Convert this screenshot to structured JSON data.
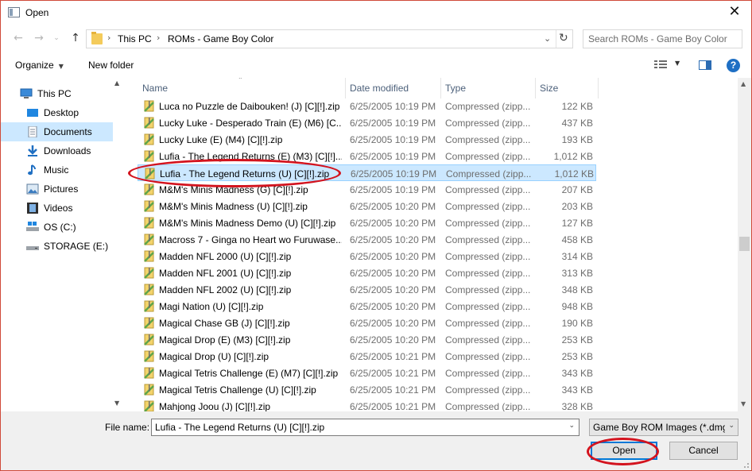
{
  "window": {
    "title": "Open",
    "close_glyph": "✕"
  },
  "address": {
    "crumbs": [
      "This PC",
      "ROMs - Game Boy Color"
    ],
    "search_placeholder": "Search ROMs - Game Boy Color"
  },
  "toolbar": {
    "organize": "Organize",
    "new_folder": "New folder",
    "help": "?"
  },
  "nav": {
    "items": [
      {
        "label": "This PC",
        "icon": "computer-icon"
      },
      {
        "label": "Desktop",
        "icon": "desktop-icon"
      },
      {
        "label": "Documents",
        "icon": "documents-icon",
        "selected": true
      },
      {
        "label": "Downloads",
        "icon": "downloads-icon"
      },
      {
        "label": "Music",
        "icon": "music-icon"
      },
      {
        "label": "Pictures",
        "icon": "pictures-icon"
      },
      {
        "label": "Videos",
        "icon": "videos-icon"
      },
      {
        "label": "OS (C:)",
        "icon": "drive-icon"
      },
      {
        "label": "STORAGE (E:)",
        "icon": "drive-icon"
      }
    ]
  },
  "list": {
    "columns": {
      "name": "Name",
      "date": "Date modified",
      "type": "Type",
      "size": "Size"
    },
    "files": [
      {
        "name": "Luca no Puzzle de Daibouken! (J) [C][!].zip",
        "date": "6/25/2005 10:19 PM",
        "type": "Compressed (zipp...",
        "size": "122 KB"
      },
      {
        "name": "Lucky Luke - Desperado Train (E) (M6) [C...",
        "date": "6/25/2005 10:19 PM",
        "type": "Compressed (zipp...",
        "size": "437 KB"
      },
      {
        "name": "Lucky Luke (E) (M4) [C][!].zip",
        "date": "6/25/2005 10:19 PM",
        "type": "Compressed (zipp...",
        "size": "193 KB"
      },
      {
        "name": "Lufia - The Legend Returns (E) (M3) [C][!]...",
        "date": "6/25/2005 10:19 PM",
        "type": "Compressed (zipp...",
        "size": "1,012 KB"
      },
      {
        "name": "Lufia - The Legend Returns (U) [C][!].zip",
        "date": "6/25/2005 10:19 PM",
        "type": "Compressed (zipp...",
        "size": "1,012 KB",
        "selected": true
      },
      {
        "name": "M&M's Minis Madness (G) [C][!].zip",
        "date": "6/25/2005 10:19 PM",
        "type": "Compressed (zipp...",
        "size": "207 KB"
      },
      {
        "name": "M&M's Minis Madness (U) [C][!].zip",
        "date": "6/25/2005 10:20 PM",
        "type": "Compressed (zipp...",
        "size": "203 KB"
      },
      {
        "name": "M&M's Minis Madness Demo (U) [C][!].zip",
        "date": "6/25/2005 10:20 PM",
        "type": "Compressed (zipp...",
        "size": "127 KB"
      },
      {
        "name": "Macross 7 - Ginga no Heart wo Furuwase...",
        "date": "6/25/2005 10:20 PM",
        "type": "Compressed (zipp...",
        "size": "458 KB"
      },
      {
        "name": "Madden NFL 2000 (U) [C][!].zip",
        "date": "6/25/2005 10:20 PM",
        "type": "Compressed (zipp...",
        "size": "314 KB"
      },
      {
        "name": "Madden NFL 2001 (U) [C][!].zip",
        "date": "6/25/2005 10:20 PM",
        "type": "Compressed (zipp...",
        "size": "313 KB"
      },
      {
        "name": "Madden NFL 2002 (U) [C][!].zip",
        "date": "6/25/2005 10:20 PM",
        "type": "Compressed (zipp...",
        "size": "348 KB"
      },
      {
        "name": "Magi Nation (U) [C][!].zip",
        "date": "6/25/2005 10:20 PM",
        "type": "Compressed (zipp...",
        "size": "948 KB"
      },
      {
        "name": "Magical Chase GB (J) [C][!].zip",
        "date": "6/25/2005 10:20 PM",
        "type": "Compressed (zipp...",
        "size": "190 KB"
      },
      {
        "name": "Magical Drop (E) (M3) [C][!].zip",
        "date": "6/25/2005 10:20 PM",
        "type": "Compressed (zipp...",
        "size": "253 KB"
      },
      {
        "name": "Magical Drop (U) [C][!].zip",
        "date": "6/25/2005 10:21 PM",
        "type": "Compressed (zipp...",
        "size": "253 KB"
      },
      {
        "name": "Magical Tetris Challenge (E) (M7) [C][!].zip",
        "date": "6/25/2005 10:21 PM",
        "type": "Compressed (zipp...",
        "size": "343 KB"
      },
      {
        "name": "Magical Tetris Challenge (U) [C][!].zip",
        "date": "6/25/2005 10:21 PM",
        "type": "Compressed (zipp...",
        "size": "343 KB"
      },
      {
        "name": "Mahjong Joou (J) [C][!].zip",
        "date": "6/25/2005 10:21 PM",
        "type": "Compressed (zipp...",
        "size": "328 KB"
      }
    ]
  },
  "bottom": {
    "file_name_label": "File name:",
    "file_name_value": "Lufia - The Legend Returns (U) [C][!].zip",
    "filter_value": "Game Boy ROM Images (*.dmg",
    "open_button": "Open",
    "cancel_button": "Cancel"
  },
  "colors": {
    "selection": "#cce8ff",
    "annotation": "#d3131e",
    "accent": "#0078d7"
  }
}
